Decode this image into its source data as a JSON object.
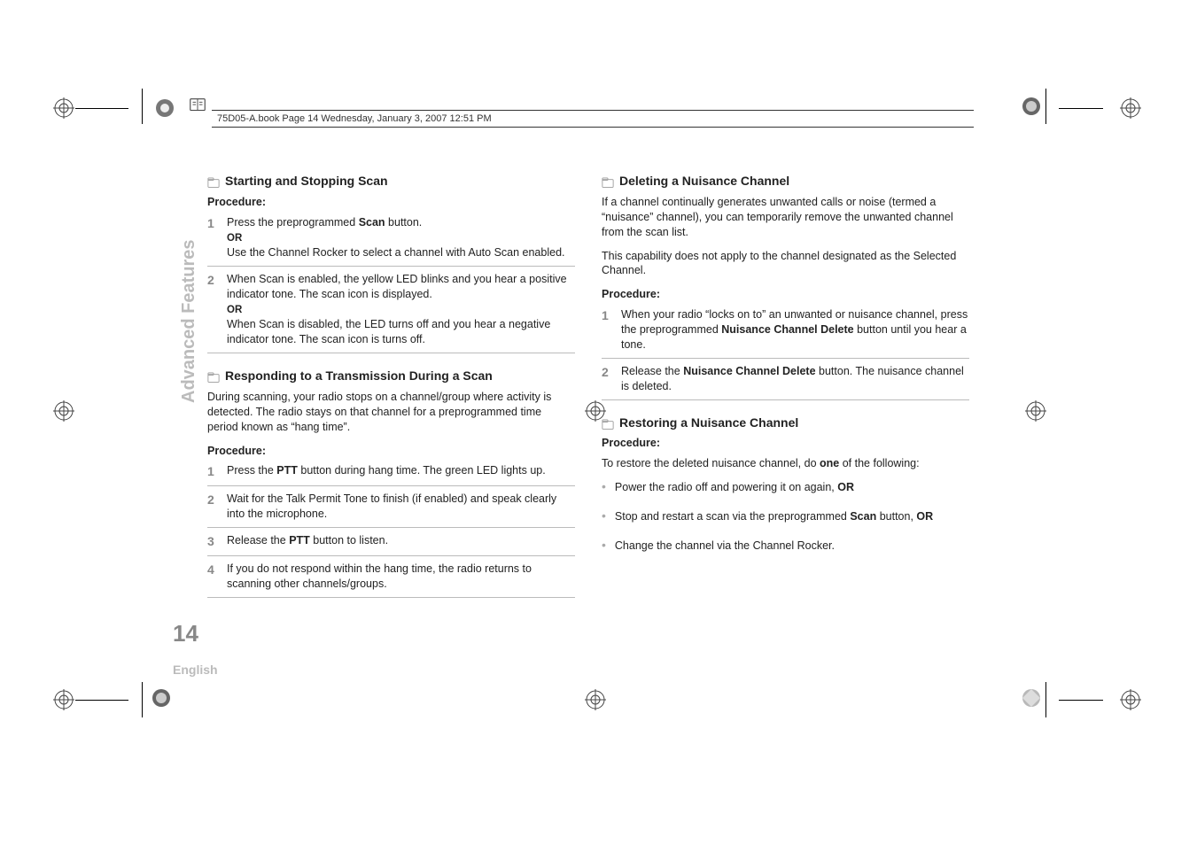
{
  "header": "75D05-A.book  Page 14  Wednesday, January 3, 2007  12:51 PM",
  "sidebar": {
    "vertical_label": "Advanced Features",
    "page_number": "14",
    "language": "English"
  },
  "left": {
    "s1_title": "Starting and Stopping Scan",
    "s1_proc": "Procedure",
    "s1_proc_colon": ":",
    "s1_step1_a": "Press the preprogrammed ",
    "s1_step1_b": "Scan",
    "s1_step1_c": " button.",
    "s1_or": "OR",
    "s1_step1_d": "Use the Channel Rocker to select a channel with Auto Scan enabled.",
    "s1_step2_a": "When Scan is enabled, the yellow LED blinks and you hear a positive indicator tone. The scan icon is displayed.",
    "s1_step2_or": "OR",
    "s1_step2_b": "When Scan is disabled, the LED turns off and you hear a negative indicator tone. The scan icon is turns off.",
    "s2_title": "Responding to a Transmission During a Scan",
    "s2_intro": "During scanning, your radio stops on a channel/group where activity is detected. The radio stays on that channel for a preprogrammed time period known as “hang time”.",
    "s2_proc": "Procedure:",
    "s2_step1_a": "Press the ",
    "s2_step1_b": "PTT",
    "s2_step1_c": " button during hang time. The green LED lights up.",
    "s2_step2": "Wait for the Talk Permit Tone to finish (if enabled) and speak clearly into the microphone.",
    "s2_step3_a": "Release the ",
    "s2_step3_b": "PTT",
    "s2_step3_c": " button to listen.",
    "s2_step4": "If you do not respond within the hang time, the radio returns to scanning other channels/groups."
  },
  "right": {
    "s3_title": "Deleting a Nuisance Channel",
    "s3_p1": "If a channel continually generates unwanted calls or noise (termed a “nuisance” channel), you can temporarily remove the unwanted channel from the scan list.",
    "s3_p2": "This capability does not apply to the channel designated as the Selected Channel.",
    "s3_proc": "Procedure:",
    "s3_step1_a": "When your radio “locks on to” an unwanted or nuisance channel, press the preprogrammed ",
    "s3_step1_b": "Nuisance Channel Delete",
    "s3_step1_c": " button until you hear a tone.",
    "s3_step2_a": "Release the ",
    "s3_step2_b": "Nuisance Channel Delete",
    "s3_step2_c": " button. The nuisance channel is deleted.",
    "s4_title": "Restoring a Nuisance Channel",
    "s4_proc": "Procedure:",
    "s4_intro_a": "To restore the deleted nuisance channel, do ",
    "s4_intro_b": "one",
    "s4_intro_c": " of the following:",
    "s4_b1_a": "Power the radio off and powering it on again, ",
    "s4_b1_b": "OR",
    "s4_b2_a": "Stop and restart a scan via the preprogrammed ",
    "s4_b2_b": "Scan",
    "s4_b2_c": " button, ",
    "s4_b2_d": "OR",
    "s4_b3": "Change the channel via the Channel Rocker."
  }
}
